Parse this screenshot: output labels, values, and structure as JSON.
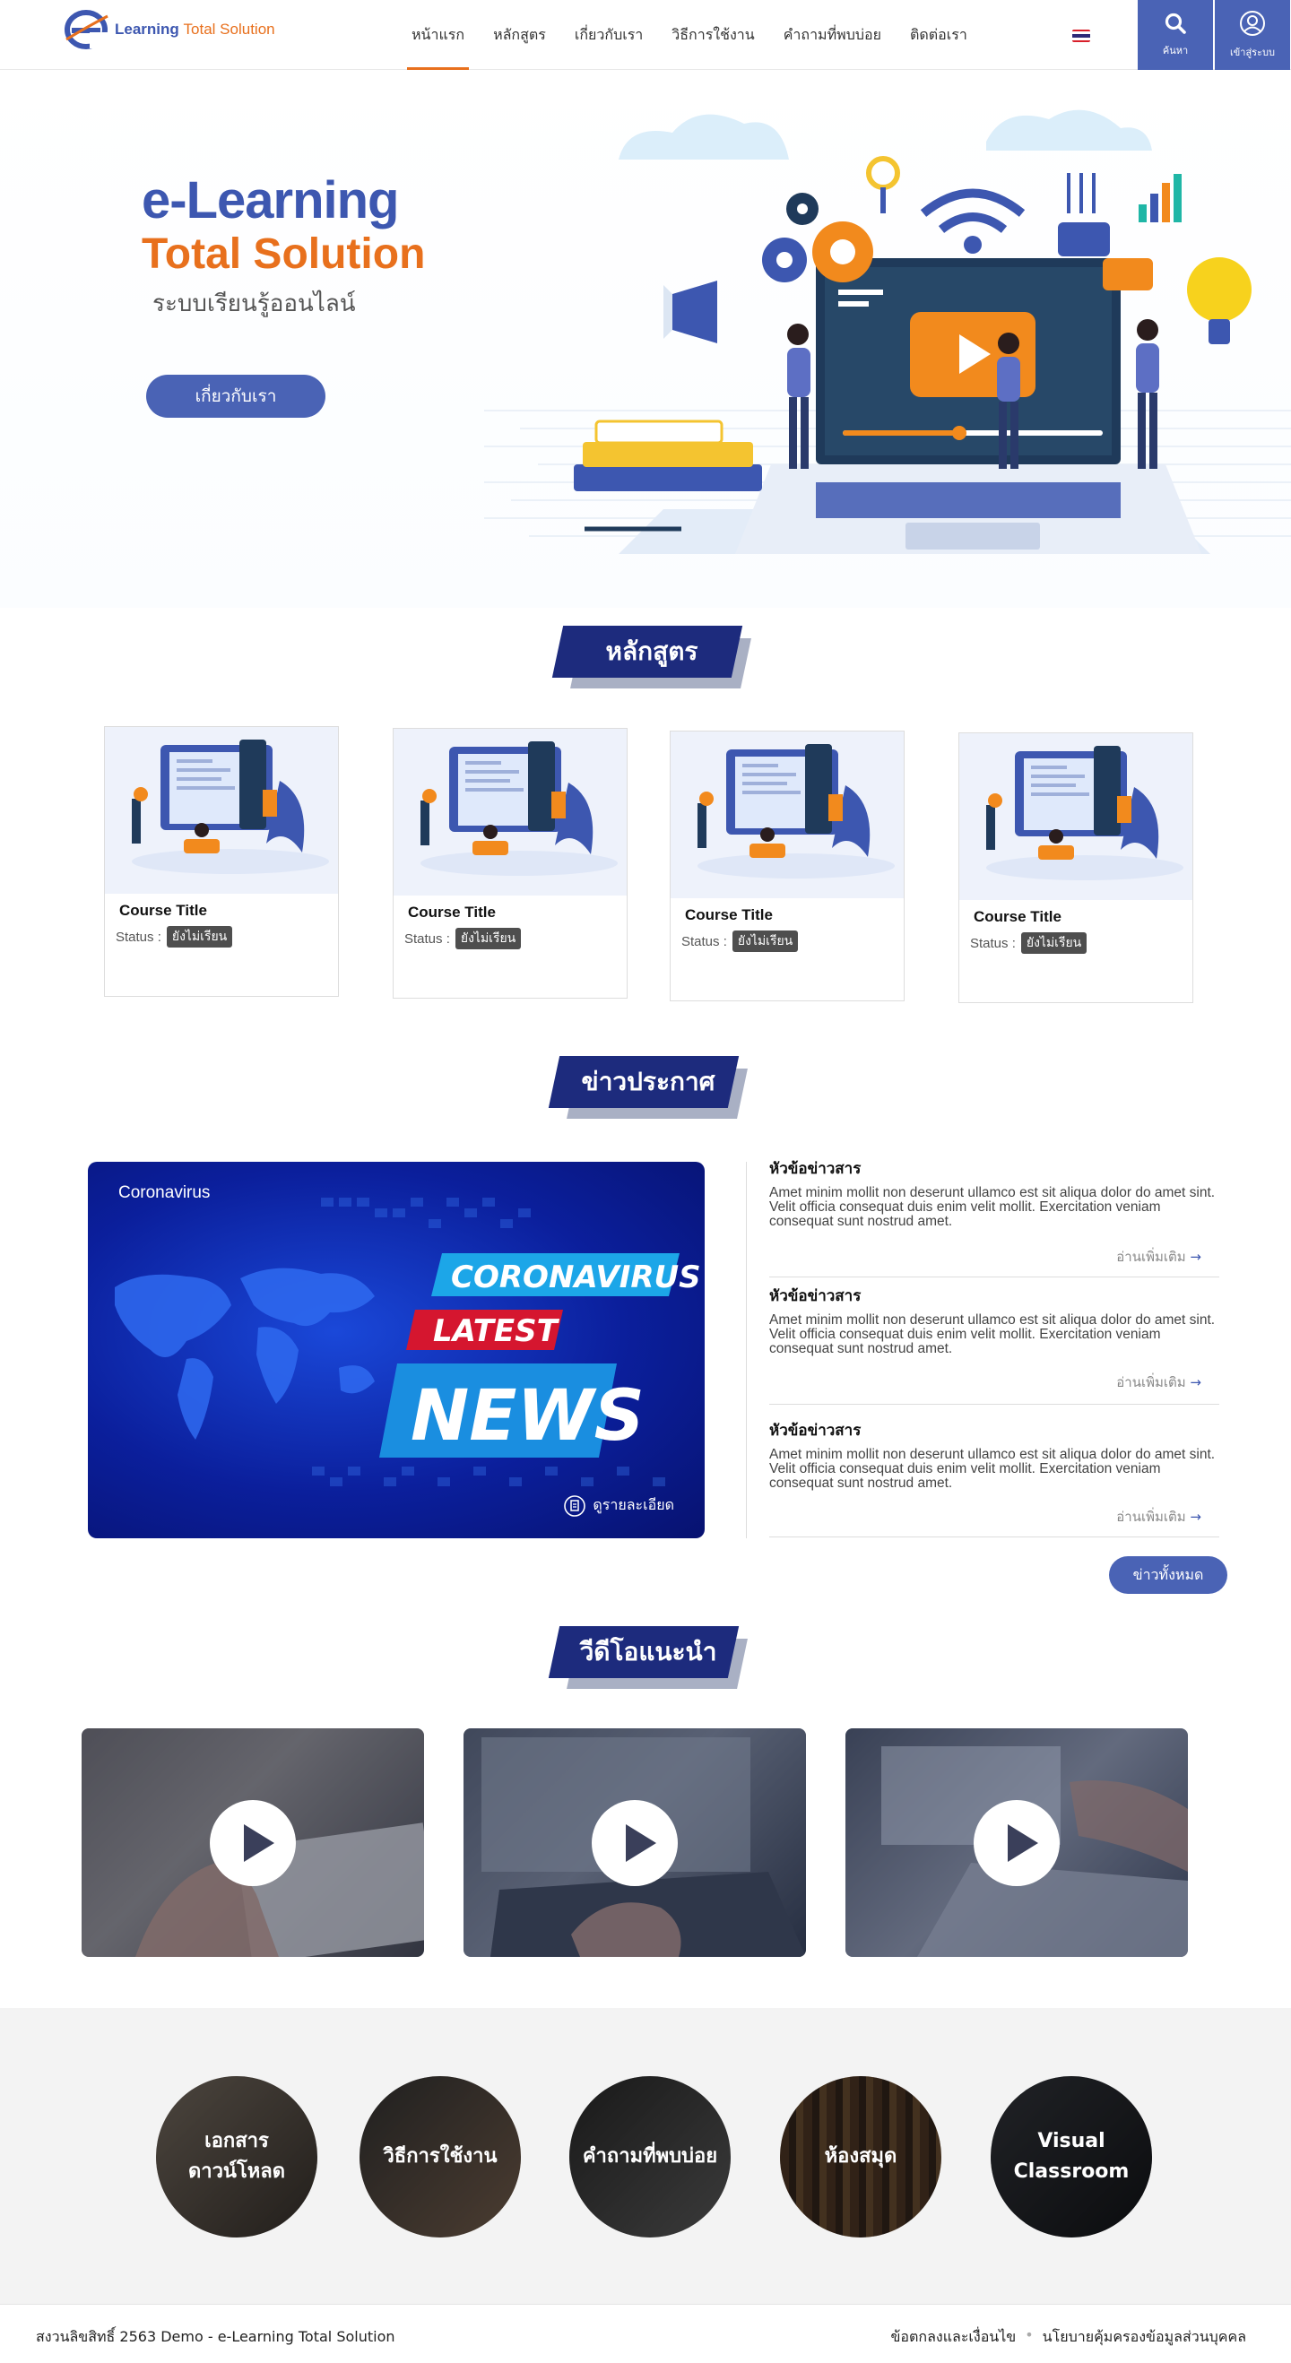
{
  "header": {
    "logo_main": "Learning",
    "logo_accent": "Total Solution",
    "nav": [
      "หน้าแรก",
      "หลักสูตร",
      "เกี่ยวกับเรา",
      "วิธีการใช้งาน",
      "คำถามที่พบบ่อย",
      "ติดต่อเรา"
    ],
    "active_nav": "หน้าแรก",
    "search_label": "ค้นหา",
    "login_label": "เข้าสู่ระบบ",
    "language_flag": "thailand-flag-icon"
  },
  "hero": {
    "title_line1": "e-Learning",
    "title_line2": "Total Solution",
    "subtitle": "ระบบเรียนรู้ออนไลน์",
    "button": "เกี่ยวกับเรา"
  },
  "courses_section": {
    "title": "หลักสูตร",
    "items": [
      {
        "title": "Course Title",
        "status_label": "Status :",
        "status": "ยังไม่เรียน"
      },
      {
        "title": "Course Title",
        "status_label": "Status :",
        "status": "ยังไม่เรียน"
      },
      {
        "title": "Course Title",
        "status_label": "Status :",
        "status": "ยังไม่เรียน"
      },
      {
        "title": "Course Title",
        "status_label": "Status :",
        "status": "ยังไม่เรียน"
      }
    ]
  },
  "news_section": {
    "title": "ข่าวประกาศ",
    "featured": {
      "category": "Coronavirus",
      "banner_line1": "CORONAVIRUS",
      "banner_line2": "LATEST",
      "banner_line3": "NEWS",
      "detail_link": "ดูรายละเอียด"
    },
    "items": [
      {
        "heading": "หัวข้อข่าวสาร",
        "body": "Amet minim mollit non deserunt ullamco est sit aliqua dolor do amet sint. Velit officia consequat duis enim velit mollit. Exercitation veniam consequat sunt nostrud amet.",
        "more": "อ่านเพิ่มเติม"
      },
      {
        "heading": "หัวข้อข่าวสาร",
        "body": "Amet minim mollit non deserunt ullamco est sit aliqua dolor do amet sint. Velit officia consequat duis enim velit mollit. Exercitation veniam consequat sunt nostrud amet.",
        "more": "อ่านเพิ่มเติม"
      },
      {
        "heading": "หัวข้อข่าวสาร",
        "body": "Amet minim mollit non deserunt ullamco est sit aliqua dolor do amet sint. Velit officia consequat duis enim velit mollit. Exercitation veniam consequat sunt nostrud amet.",
        "more": "อ่านเพิ่มเติม"
      }
    ],
    "all_button": "ข่าวทั้งหมด"
  },
  "video_section": {
    "title": "วีดีโอแนะนำ"
  },
  "quick_links": [
    "เอกสาร ดาวน์โหลด",
    "วิธีการใช้งาน",
    "คำถามที่พบบ่อย",
    "ห้องสมุด",
    "Visual Classroom"
  ],
  "footer": {
    "copyright": "สงวนลิขสิทธิ์ 2563 Demo - e-Learning Total Solution",
    "link1": "ข้อตกลงและเงื่อนไข",
    "link2": "นโยบายคุ้มครองข้อมูลส่วนบุคคล"
  },
  "colors": {
    "primary": "#4a63b5",
    "accent": "#e8701d",
    "navy": "#1d2b7d"
  }
}
